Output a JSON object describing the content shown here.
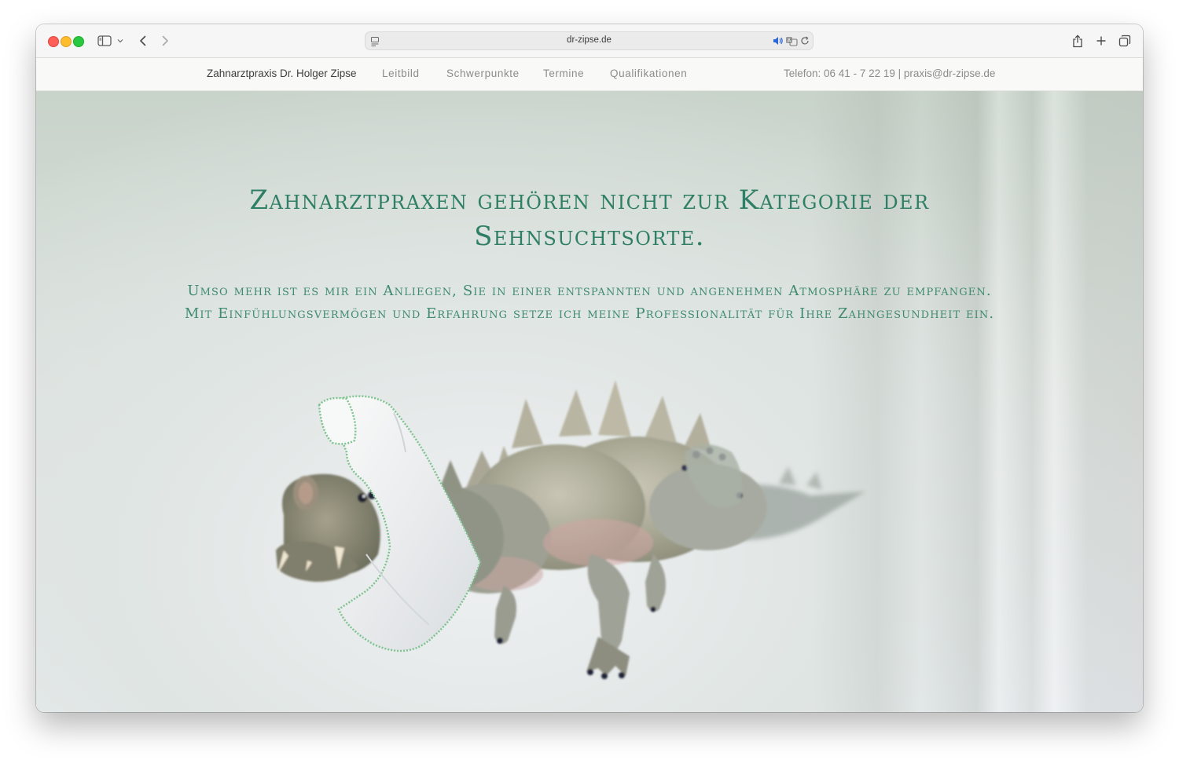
{
  "browser": {
    "url": "dr-zipse.de"
  },
  "site": {
    "brand": "Zahnarztpraxis Dr. Holger Zipse",
    "nav": [
      "Leitbild",
      "Schwerpunkte",
      "Termine",
      "Qualifikationen"
    ],
    "contact": "Telefon: 06 41 - 7 22 19 | praxis@dr-zipse.de"
  },
  "hero": {
    "headline_line1": "Zahnarztpraxen gehören nicht zur Kategorie der",
    "headline_line2": "Sehnsuchtsorte.",
    "sub_line1": "Umso mehr ist es mir ein Anliegen, Sie in einer entspannten und angenehmen Atmosphäre zu empfangen.",
    "sub_line2": "Mit Einfühlungsvermögen und Erfahrung setze ich meine Professionalität für Ihre Zahngesundheit ein.",
    "accent_color": "#2f7f66"
  }
}
